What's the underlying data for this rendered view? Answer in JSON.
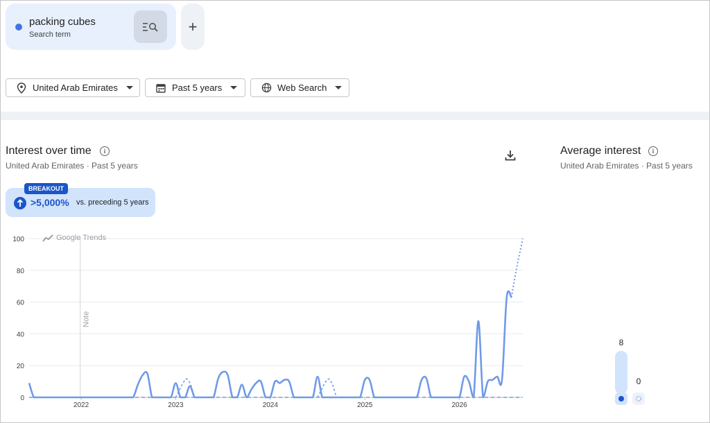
{
  "search_term": {
    "name": "packing cubes",
    "type_label": "Search term",
    "color": "#4374e0",
    "add_label": "+"
  },
  "filters": {
    "location": "United Arab Emirates",
    "time_range": "Past 5 years",
    "property": "Web Search"
  },
  "interest_panel": {
    "title": "Interest over time",
    "subtitle": "United Arab Emirates · Past 5 years",
    "breakout_tag": "BREAKOUT",
    "breakout_value": ">5,000%",
    "breakout_vs": "vs. preceding 5 years",
    "watermark": "Google Trends",
    "note_label": "Note"
  },
  "average_panel": {
    "title": "Average interest",
    "subtitle": "United Arab Emirates · Past 5 years"
  },
  "chart_data": [
    {
      "type": "line",
      "title": "",
      "ylim": [
        0,
        100
      ],
      "yticks": [
        0,
        20,
        40,
        60,
        80,
        100
      ],
      "xlim": [
        2021.45,
        2026.67
      ],
      "xticks": [
        2022,
        2023,
        2024,
        2025,
        2026
      ],
      "xtick_labels": [
        "2022",
        "2023",
        "2024",
        "2025",
        "2026"
      ],
      "grid": true,
      "note_x": 2021.99,
      "series": [
        {
          "name": "packing cubes",
          "color": "#6f9ae8",
          "x": [
            2021.45,
            2021.5,
            2021.55,
            2021.6,
            2021.7,
            2021.8,
            2021.9,
            2022.0,
            2022.1,
            2022.2,
            2022.3,
            2022.35,
            2022.4,
            2022.45,
            2022.5,
            2022.55,
            2022.6,
            2022.65,
            2022.7,
            2022.75,
            2022.8,
            2022.85,
            2022.9,
            2022.95,
            2023.0,
            2023.05,
            2023.1,
            2023.15,
            2023.2,
            2023.25,
            2023.3,
            2023.35,
            2023.4,
            2023.45,
            2023.5,
            2023.55,
            2023.6,
            2023.65,
            2023.7,
            2023.75,
            2023.8,
            2023.85,
            2023.9,
            2023.95,
            2024.0,
            2024.05,
            2024.1,
            2024.15,
            2024.2,
            2024.25,
            2024.3,
            2024.35,
            2024.4,
            2024.45,
            2024.5,
            2024.55,
            2024.6,
            2024.65,
            2024.7,
            2024.75,
            2024.8,
            2024.85,
            2024.9,
            2024.95,
            2025.0,
            2025.05,
            2025.1,
            2025.15,
            2025.2,
            2025.25,
            2025.3,
            2025.35,
            2025.4,
            2025.45,
            2025.5,
            2025.55,
            2025.6,
            2025.65,
            2025.7,
            2025.75,
            2025.8,
            2025.85,
            2025.9,
            2025.95,
            2026.0,
            2026.05,
            2026.1,
            2026.15,
            2026.2,
            2026.25,
            2026.3,
            2026.35,
            2026.4,
            2026.45,
            2026.5,
            2026.55
          ],
          "y": [
            9,
            0,
            0,
            0,
            0,
            0,
            0,
            0,
            0,
            0,
            0,
            0,
            0,
            0,
            0,
            0,
            8,
            14,
            15,
            0,
            0,
            0,
            0,
            0,
            9,
            0,
            0,
            7,
            0,
            0,
            0,
            0,
            0,
            12,
            16,
            14,
            0,
            0,
            8,
            0,
            5,
            9,
            10,
            0,
            0,
            10,
            9,
            11,
            10,
            0,
            0,
            0,
            0,
            0,
            13,
            0,
            0,
            0,
            0,
            0,
            0,
            0,
            0,
            0,
            11,
            11,
            0,
            0,
            0,
            0,
            0,
            0,
            0,
            0,
            0,
            0,
            11,
            12,
            0,
            0,
            0,
            0,
            0,
            0,
            0,
            13,
            10,
            0,
            48,
            0,
            10,
            11,
            13,
            11,
            63,
            63
          ]
        },
        {
          "name": "packing cubes (partial)",
          "color": "#6f9ae8",
          "dotted": true,
          "x": [
            2026.55,
            2026.6,
            2026.67
          ],
          "y": [
            63,
            80,
            100
          ]
        }
      ],
      "dashed_segments": [
        {
          "x": [
            2023.0,
            2023.1,
            2023.15,
            2023.2
          ],
          "y": [
            0,
            11,
            9,
            0
          ]
        },
        {
          "x": [
            2024.5,
            2024.6,
            2024.65,
            2024.7
          ],
          "y": [
            0,
            11,
            9,
            0
          ]
        }
      ]
    },
    {
      "type": "bar",
      "title": "",
      "categories": [
        "packing cubes",
        "comparison"
      ],
      "values": [
        8,
        0
      ],
      "ylim": [
        0,
        100
      ]
    }
  ]
}
